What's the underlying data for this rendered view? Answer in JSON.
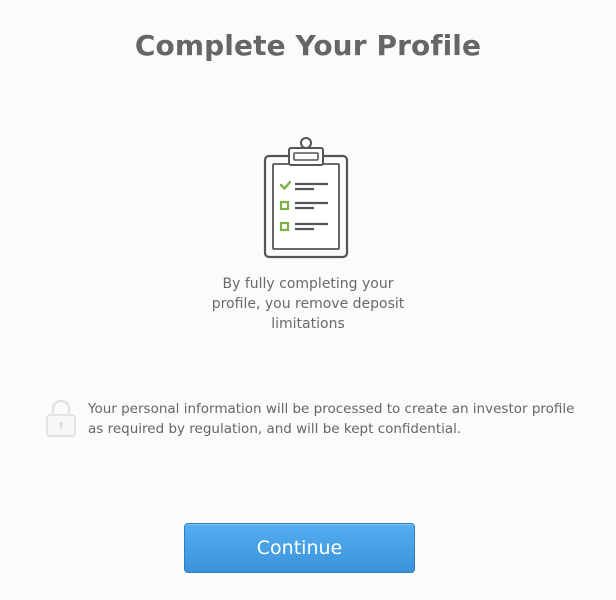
{
  "header": {
    "title": "Complete Your Profile"
  },
  "illustration": {
    "icon": "clipboard-checklist-icon",
    "accent_color": "#7cb342",
    "line_color": "#555555"
  },
  "main": {
    "description": "By fully completing your profile, you remove deposit limitations"
  },
  "privacy_notice": {
    "icon": "lock-icon",
    "text": "Your personal information will be processed to create an investor profile as required by regulation, and will be kept confidential."
  },
  "actions": {
    "continue_label": "Continue",
    "button_color": "#4aa3e8"
  }
}
